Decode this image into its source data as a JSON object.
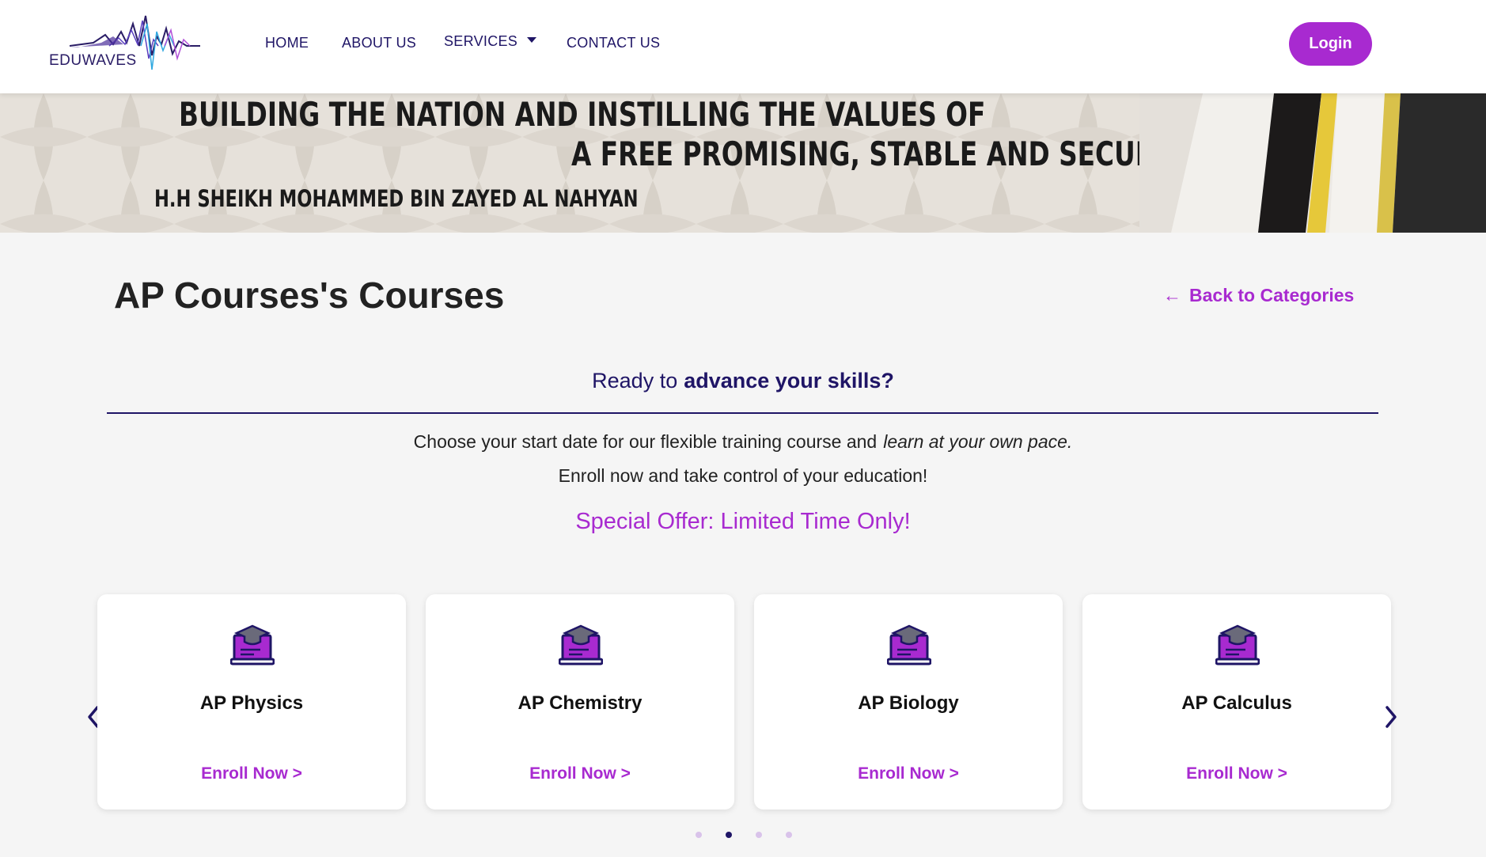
{
  "header": {
    "logo_text": "EDUWAVES",
    "nav": [
      {
        "label": "HOME"
      },
      {
        "label": "ABOUT US"
      },
      {
        "label": "SERVICES"
      },
      {
        "label": "CONTACT US"
      }
    ],
    "login_label": "Login"
  },
  "banner": {
    "quote_line_1": "BUILDING THE NATION AND INSTILLING THE VALUES OF",
    "quote_line_2": "A FREE PROMISING, STABLE AND SECURE LIFE.\"",
    "quote_author": "H.H SHEIKH MOHAMMED BIN ZAYED AL NAHYAN"
  },
  "main": {
    "title": "AP Courses's Courses",
    "back_label": "Back to Categories",
    "ready_prefix": "Ready to",
    "ready_strong": "advance your skills?",
    "desc_line1_prefix": "Choose your start date for our flexible training course and",
    "desc_line1_em": "learn at your own pace.",
    "desc_line2": "Enroll now and take control of your education!",
    "offer": "Special Offer: Limited Time Only!"
  },
  "courses": [
    {
      "title": "AP Physics",
      "enroll": "Enroll Now >"
    },
    {
      "title": "AP Chemistry",
      "enroll": "Enroll Now >"
    },
    {
      "title": "AP Biology",
      "enroll": "Enroll Now >"
    },
    {
      "title": "AP Calculus",
      "enroll": "Enroll Now >"
    }
  ],
  "carousel": {
    "pages": 4,
    "active_page": 2
  },
  "colors": {
    "accent": "#a82ad0",
    "navy": "#1f1566",
    "background": "#f5f5f5"
  }
}
